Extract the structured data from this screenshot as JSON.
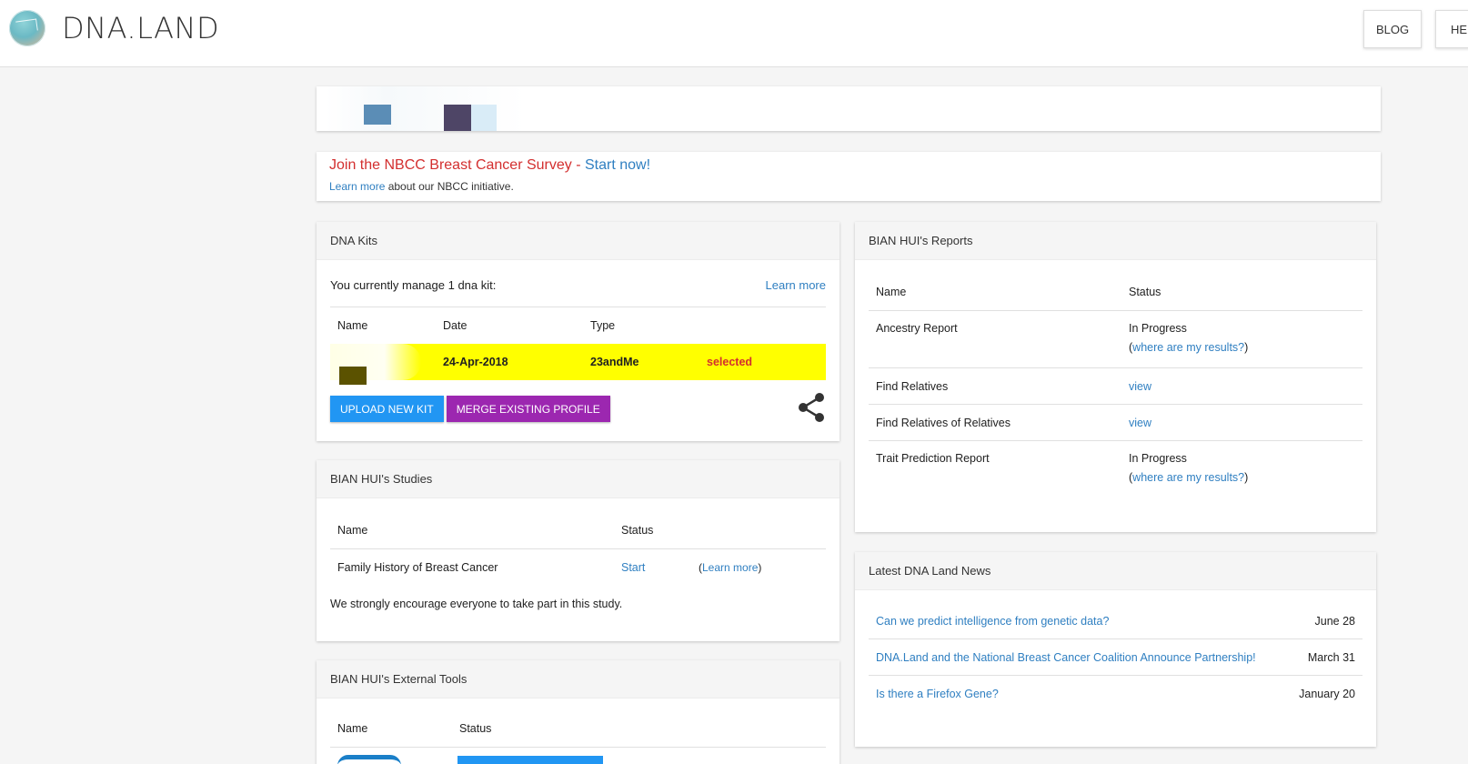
{
  "header": {
    "logo_text": "DNA.LAND",
    "nav": [
      {
        "label": "BLOG"
      },
      {
        "label": "HE"
      }
    ]
  },
  "survey": {
    "title": "Join the NBCC Breast Cancer Survey - ",
    "title_link": "Start now!",
    "learn_link": "Learn more",
    "learn_rest": " about our NBCC initiative."
  },
  "kits": {
    "header": "DNA Kits",
    "manage_text": "You currently manage 1 dna kit:",
    "learn_more": "Learn more",
    "columns": [
      "Name",
      "Date",
      "Type"
    ],
    "row": {
      "name": "",
      "date": "24-Apr-2018",
      "type": "23andMe",
      "status": "selected"
    },
    "upload_btn": "UPLOAD NEW KIT",
    "merge_btn": "MERGE EXISTING PROFILE"
  },
  "studies": {
    "header": "BIAN HUI's Studies",
    "columns": [
      "Name",
      "Status"
    ],
    "rows": [
      {
        "name": "Family History of Breast Cancer",
        "status": "Start",
        "paren_open": "(",
        "learn": "Learn more",
        "paren_close": ")"
      }
    ],
    "note": "We strongly encourage everyone to take part in this study."
  },
  "tools": {
    "header": "BIAN HUI's External Tools",
    "columns": [
      "Name",
      "Status"
    ]
  },
  "reports": {
    "header": "BIAN HUI's Reports",
    "columns": [
      "Name",
      "Status"
    ],
    "rows": [
      {
        "name": "Ancestry Report",
        "status": "In Progress",
        "sub_open": "(",
        "sub_link": "where are my results?",
        "sub_close": ")"
      },
      {
        "name": "Find Relatives",
        "status": "view"
      },
      {
        "name": "Find Relatives of Relatives",
        "status": "view"
      },
      {
        "name": "Trait Prediction Report",
        "status": "In Progress",
        "sub_open": "(",
        "sub_link": "where are my results?",
        "sub_close": ")"
      }
    ]
  },
  "news": {
    "header": "Latest DNA Land News",
    "items": [
      {
        "title": "Can we predict intelligence from genetic data?",
        "date": "June 28"
      },
      {
        "title": "DNA.Land and the National Breast Cancer Coalition Announce Partnership!",
        "date": "March 31"
      },
      {
        "title": "Is there a Firefox Gene?",
        "date": "January 20"
      }
    ]
  },
  "colors": {
    "accent_blue": "#2196f3",
    "accent_purple": "#9c27b0",
    "selected_row": "#ffff00",
    "survey_red": "#d32f2f",
    "link": "#2f7fc1"
  }
}
